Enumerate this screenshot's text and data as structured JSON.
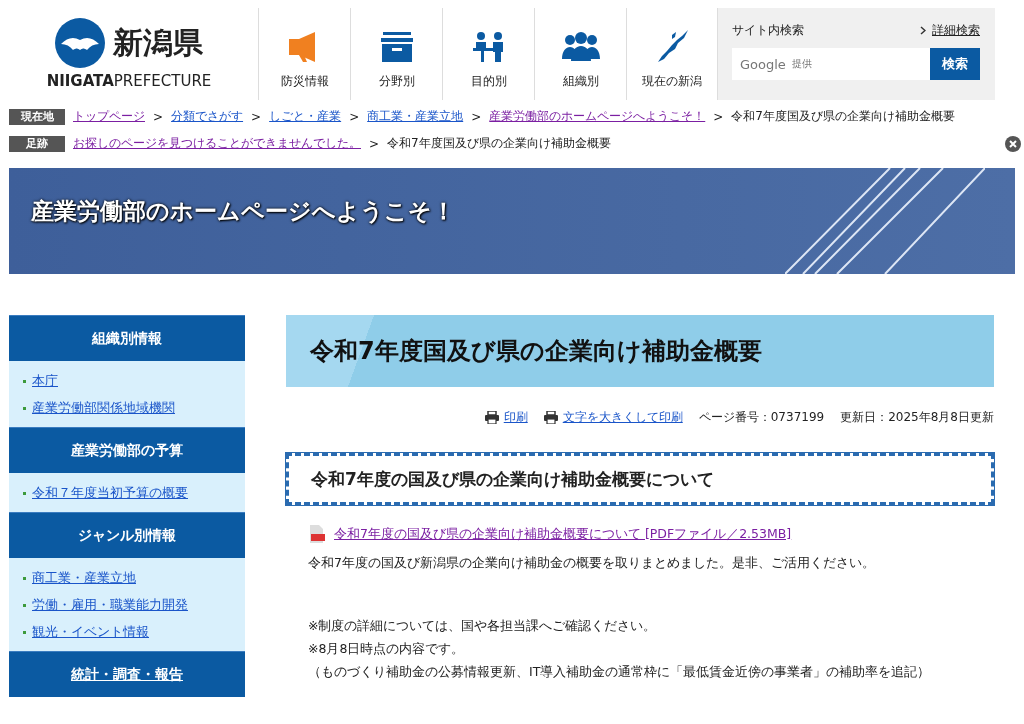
{
  "logo": {
    "name": "新潟県",
    "sub_bold": "NIIGATA",
    "sub": "PREFECTURE"
  },
  "nav": [
    {
      "label": "防災情報",
      "kind": "megaphone"
    },
    {
      "label": "分野別",
      "kind": "box"
    },
    {
      "label": "目的別",
      "kind": "counter"
    },
    {
      "label": "組織別",
      "kind": "people"
    },
    {
      "label": "現在の新潟",
      "kind": "map"
    }
  ],
  "search": {
    "title": "サイト内検索",
    "advanced": "詳細検索",
    "placeholder_brand": "Google",
    "placeholder_note": "提供",
    "button": "検索"
  },
  "breadcrumbs": [
    {
      "label": "現在地",
      "links": [
        {
          "text": "トップページ",
          "visited": true
        },
        {
          "text": "分類でさがす",
          "visited": false
        },
        {
          "text": "しごと・産業",
          "visited": false
        },
        {
          "text": "商工業・産業立地",
          "visited": false
        },
        {
          "text": "産業労働部のホームページへようこそ！",
          "visited": true
        }
      ],
      "separators": [
        ">",
        ">",
        ">",
        ">",
        ">"
      ],
      "current": "令和7年度国及び県の企業向け補助金概要",
      "closable": false
    },
    {
      "label": "足跡",
      "links": [
        {
          "text": "お探しのページを見つけることができませんでした。",
          "visited": true
        }
      ],
      "separators": [
        ">"
      ],
      "current": "令和7年度国及び県の企業向け補助金概要",
      "closable": true
    }
  ],
  "banner": {
    "title": "産業労働部のホームページへようこそ！"
  },
  "sidebar": [
    {
      "heading": "組織別情報",
      "heading_link": false,
      "items": [
        "本庁",
        "産業労働部関係地域機関"
      ]
    },
    {
      "heading": "産業労働部の予算",
      "heading_link": false,
      "items": [
        "令和７年度当初予算の概要"
      ]
    },
    {
      "heading": "ジャンル別情報",
      "heading_link": false,
      "items": [
        "商工業・産業立地",
        "労働・雇用・職業能力開発",
        "観光・イベント情報"
      ]
    },
    {
      "heading": "統計・調査・報告",
      "heading_link": true
    }
  ],
  "page": {
    "title": "令和7年度国及び県の企業向け補助金概要",
    "tools": [
      {
        "text": "印刷"
      },
      {
        "text": "文字を大きくして印刷"
      }
    ],
    "page_number": "ページ番号：0737199",
    "updated": "更新日：2025年8月8日更新",
    "section_title": "令和7年度の国及び県の企業向け補助金概要について",
    "pdf_link": {
      "text": "令和7年度の国及び県の企業向け補助金概要について [PDFファイル／2.53MB]",
      "visited": true
    },
    "paragraphs": [
      "令和7年度の国及び新潟県の企業向け補助金の概要を取りまとめました。是非、ご活用ください。"
    ],
    "notes": [
      "※制度の詳細については、国や各担当課へご確認ください。",
      "※8月8日時点の内容です。",
      "（ものづくり補助金の公募情報更新、IT導入補助金の通常枠に「最低賃金近傍の事業者」の補助率を追記）"
    ]
  }
}
